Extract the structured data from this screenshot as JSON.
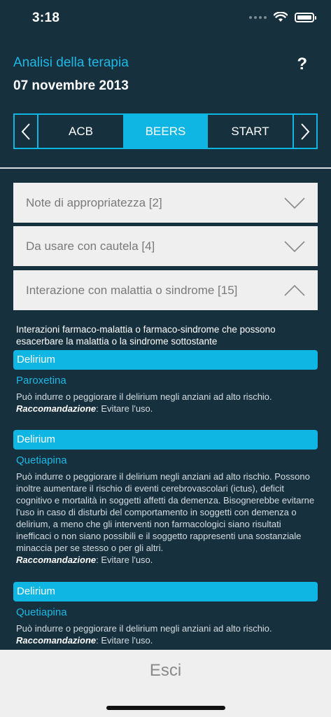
{
  "status_bar": {
    "time": "3:18"
  },
  "header": {
    "title": "Analisi della terapia",
    "date": "07 novembre 2013",
    "help_label": "?"
  },
  "tabs": [
    {
      "label": "ACB",
      "active": false
    },
    {
      "label": "BEERS",
      "active": true
    },
    {
      "label": "START",
      "active": false
    }
  ],
  "accordions": [
    {
      "label": "Note di appropriatezza [2]",
      "expanded": false
    },
    {
      "label": "Da usare con cautela [4]",
      "expanded": false
    },
    {
      "label": "Interazione con malattia o sindrome [15]",
      "expanded": true
    }
  ],
  "section": {
    "description": "Interazioni farmaco-malattia o farmaco-sindrome che possono esacerbare la malattia o la sindrome sottostante"
  },
  "entries": [
    {
      "condition": "Delirium",
      "drug": "Paroxetina",
      "text": "Può indurre o peggiorare il delirium negli anziani ad alto rischio.",
      "rec_label": "Raccomandazione",
      "rec_text": ": Evitare l'uso."
    },
    {
      "condition": "Delirium",
      "drug": "Quetiapina",
      "text": "Può indurre o peggiorare il delirium negli anziani ad alto rischio. Possono inoltre aumentare il rischio di eventi cerebrovascolari (ictus), deficit cognitivo e mortalità in soggetti affetti da demenza. Bisognerebbe evitarne l'uso in caso di disturbi del comportamento in soggetti con demenza o delirium, a meno che gli interventi non farmacologici siano risultati inefficaci o non siano possibili e il soggetto rappresenti una sostanziale minaccia per se stesso o per gli altri.",
      "rec_label": "Raccomandazione",
      "rec_text": ": Evitare l'uso."
    },
    {
      "condition": "Delirium",
      "drug": "Quetiapina",
      "text": "Può indurre o peggiorare il delirium negli anziani ad alto rischio.",
      "rec_label": "Raccomandazione",
      "rec_text": ": Evitare l'uso."
    }
  ],
  "footer": {
    "exit_label": "Esci"
  },
  "colors": {
    "background": "#16303e",
    "accent": "#0fb6e4",
    "accordion_bg": "#efefef"
  }
}
